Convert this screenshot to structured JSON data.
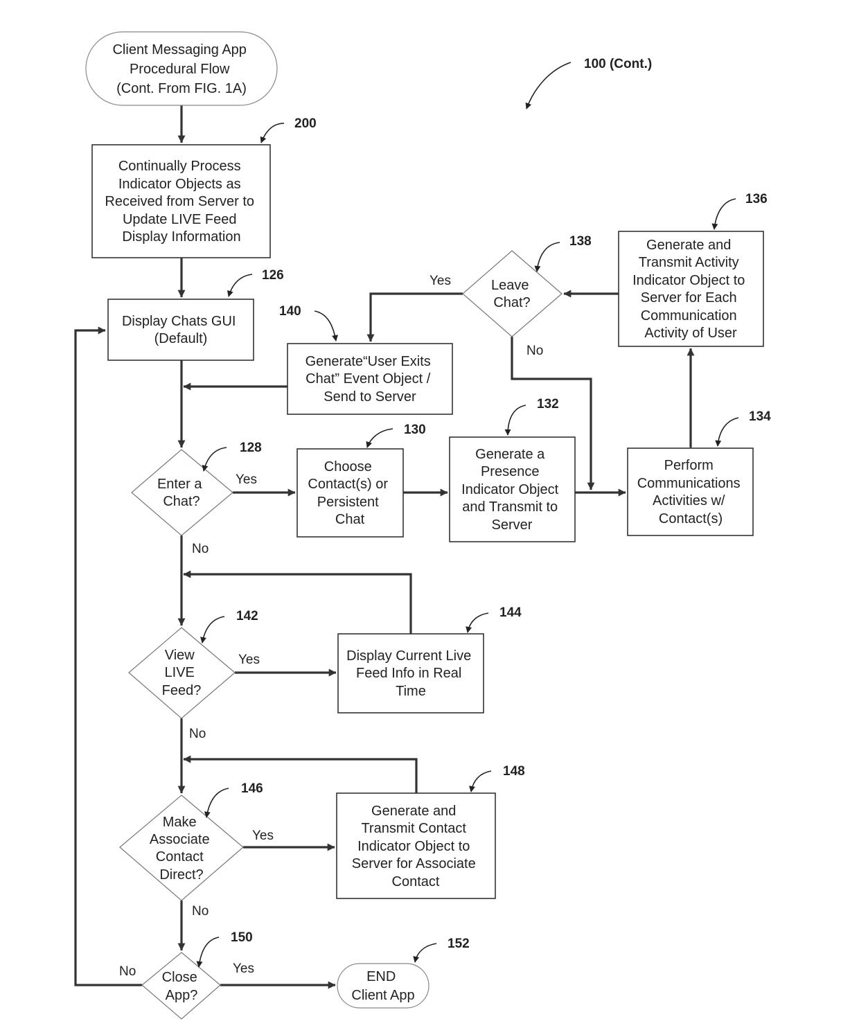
{
  "figure": {
    "ref": "100 (Cont.)"
  },
  "nodes": {
    "start": {
      "ref": "",
      "lines": [
        "Client Messaging App",
        "Procedural Flow",
        "(Cont. From FIG. 1A)"
      ]
    },
    "n200": {
      "ref": "200",
      "lines": [
        "Continually Process",
        "Indicator Objects as",
        "Received from Server to",
        "Update LIVE Feed",
        "Display Information"
      ]
    },
    "n126": {
      "ref": "126",
      "lines": [
        "Display Chats GUI",
        "(Default)"
      ]
    },
    "n140": {
      "ref": "140",
      "lines": [
        "Generate“User Exits",
        "Chat” Event Object /",
        "Send to Server"
      ]
    },
    "n138": {
      "ref": "138",
      "lines": [
        "Leave",
        "Chat?"
      ]
    },
    "n136": {
      "ref": "136",
      "lines": [
        "Generate and",
        "Transmit Activity",
        "Indicator Object to",
        "Server for Each",
        "Communication",
        "Activity of User"
      ]
    },
    "n128": {
      "ref": "128",
      "lines": [
        "Enter a",
        "Chat?"
      ]
    },
    "n130": {
      "ref": "130",
      "lines": [
        "Choose",
        "Contact(s) or",
        "Persistent",
        "Chat"
      ]
    },
    "n132": {
      "ref": "132",
      "lines": [
        "Generate a",
        "Presence",
        "Indicator Object",
        "and Transmit to",
        "Server"
      ]
    },
    "n134": {
      "ref": "134",
      "lines": [
        "Perform",
        "Communications",
        "Activities w/",
        "Contact(s)"
      ]
    },
    "n142": {
      "ref": "142",
      "lines": [
        "View",
        "LIVE",
        "Feed?"
      ]
    },
    "n144": {
      "ref": "144",
      "lines": [
        "Display Current Live",
        "Feed Info in Real",
        "Time"
      ]
    },
    "n146": {
      "ref": "146",
      "lines": [
        "Make",
        "Associate",
        "Contact",
        "Direct?"
      ]
    },
    "n148": {
      "ref": "148",
      "lines": [
        "Generate and",
        "Transmit Contact",
        "Indicator Object to",
        "Server for Associate",
        "Contact"
      ]
    },
    "n150": {
      "ref": "150",
      "lines": [
        "Close",
        "App?"
      ]
    },
    "n152": {
      "ref": "152",
      "lines": [
        "END",
        "Client App"
      ]
    }
  },
  "edge_labels": {
    "leave_yes": "Yes",
    "leave_no": "No",
    "enter_yes": "Yes",
    "enter_no": "No",
    "view_yes": "Yes",
    "view_no": "No",
    "make_yes": "Yes",
    "make_no": "No",
    "close_yes": "Yes",
    "close_no": "No"
  }
}
